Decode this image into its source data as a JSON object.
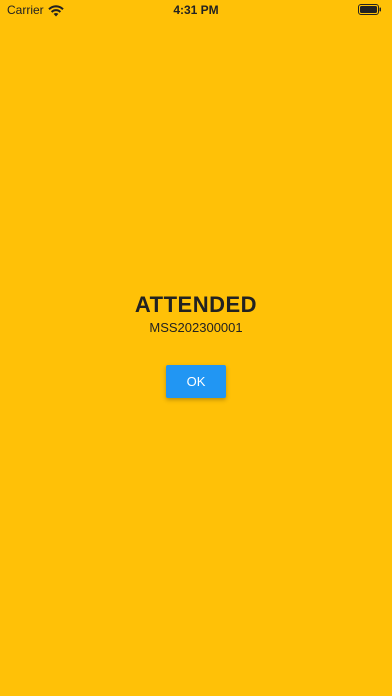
{
  "status_bar": {
    "carrier": "Carrier",
    "time": "4:31 PM",
    "wifi_icon": "wifi-icon",
    "battery_icon": "battery-icon"
  },
  "main": {
    "title": "ATTENDED",
    "subtitle": "MSS202300001",
    "ok_label": "OK"
  },
  "colors": {
    "background": "#FFC107",
    "button": "#2196F3",
    "text": "#222222",
    "button_text": "#FFFFFF"
  }
}
